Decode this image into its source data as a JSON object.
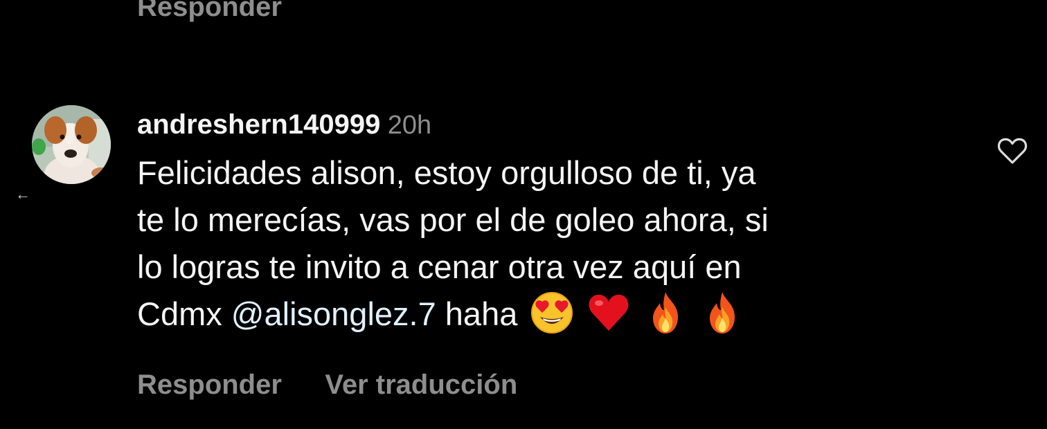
{
  "previous_comment": {
    "reply_label": "Responder"
  },
  "comment": {
    "username": "andreshern140999",
    "time_ago": "20h",
    "text_lines": [
      "Felicidades alison, estoy orgulloso de ti, ya",
      "te lo merecías, vas por el de goleo ahora, si",
      "lo logras te invito a cenar otra vez aquí en"
    ],
    "last_line_prefix": "Cdmx ",
    "mention": "@alisonglez.7",
    "last_line_suffix": " haha",
    "emojis": [
      "heart-eyes-icon",
      "red-heart-icon",
      "fire-icon",
      "fire-icon"
    ],
    "actions": {
      "reply_label": "Responder",
      "translate_label": "Ver traducción"
    }
  },
  "icons": {
    "back": "←",
    "like": "heart-outline-icon",
    "avatar": "dog-avatar"
  },
  "colors": {
    "background": "#000000",
    "text": "#f5f5f5",
    "muted": "#8e8e8e",
    "mention": "#e0f1ff"
  }
}
